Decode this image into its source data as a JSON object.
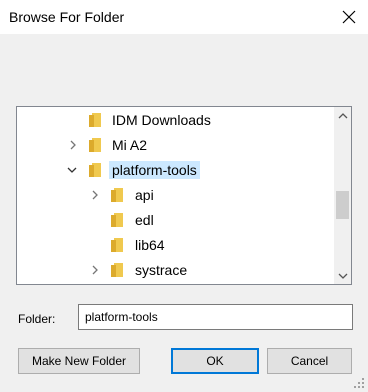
{
  "window": {
    "title": "Browse For Folder"
  },
  "tree": {
    "items": [
      {
        "label": "IDM Downloads",
        "expander": "none",
        "selected": false
      },
      {
        "label": "Mi A2",
        "expander": "collapsed",
        "selected": false
      },
      {
        "label": "platform-tools",
        "expander": "expanded",
        "selected": true
      },
      {
        "label": "api",
        "expander": "collapsed",
        "selected": false
      },
      {
        "label": "edl",
        "expander": "none",
        "selected": false
      },
      {
        "label": "lib64",
        "expander": "none",
        "selected": false
      },
      {
        "label": "systrace",
        "expander": "collapsed",
        "selected": false
      }
    ]
  },
  "folder_field": {
    "label": "Folder:",
    "value": "platform-tools"
  },
  "buttons": {
    "new_folder": "Make New Folder",
    "ok": "OK",
    "cancel": "Cancel"
  },
  "colors": {
    "selection": "#cce8ff",
    "folder": "#f0c94f",
    "accent": "#0078d7"
  }
}
